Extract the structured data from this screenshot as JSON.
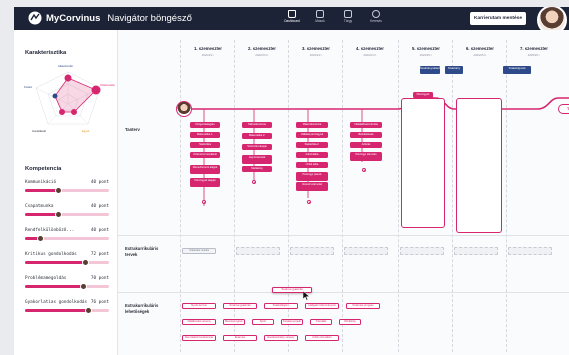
{
  "app": {
    "brand_bold": "MyCorvinus",
    "brand_rest": "Navigátor böngésző",
    "career_button": "Karrierutam mentése"
  },
  "nav": [
    {
      "label": "Dashboard",
      "icon": "home-icon",
      "active": true
    },
    {
      "label": "Mások",
      "icon": "document-icon",
      "active": false
    },
    {
      "label": "Tárgy",
      "icon": "file-icon",
      "active": false
    },
    {
      "label": "Keresés",
      "icon": "search-icon",
      "active": false
    }
  ],
  "left": {
    "characteristics_title": "Karakterisztika",
    "radar_labels": {
      "top": "Adatorientált",
      "right": "Üzletvezetés",
      "left": "Kreatív",
      "bottom_left": "Gondolkodó",
      "bottom_right": "Egyéb"
    },
    "competence_title": "Kompetencia",
    "skills": [
      {
        "name": "Kommunikáció",
        "points": "40 pont",
        "level": 0.4
      },
      {
        "name": "Csapatmunka",
        "points": "40 pont",
        "level": 0.4
      },
      {
        "name": "Rendfelkülönböző...",
        "points": "40 pont",
        "level": 0.18
      },
      {
        "name": "Kritikus gondolkodás",
        "points": "72 pont",
        "level": 0.72
      },
      {
        "name": "Problémamegoldás",
        "points": "70 pont",
        "level": 0.7
      },
      {
        "name": "Gyakorlatias gondolkodás",
        "points": "76 pont",
        "level": 0.76
      }
    ]
  },
  "semesters": [
    {
      "title": "1. szemeszter",
      "dates": "2022/23 I."
    },
    {
      "title": "2. szemeszter",
      "dates": "2022/23 II."
    },
    {
      "title": "3. szemeszter",
      "dates": "2023/24 I."
    },
    {
      "title": "4. szemeszter",
      "dates": "2023/24 II."
    },
    {
      "title": "5. szemeszter",
      "dates": "2024/25 I."
    },
    {
      "title": "6. szemeszter",
      "dates": "2024/25 II."
    },
    {
      "title": "7. szemeszter",
      "dates": "2025/26 I."
    }
  ],
  "semester_tags": [
    "Szakirányválasztás",
    "Szakirány",
    "Szakdolgozat"
  ],
  "rows": {
    "curriculum": "Tanterv",
    "extracurricular_plans": "Extrakurrikuláris tervek",
    "extracurricular_options": "Extrakurrikuláris lehetőségek"
  },
  "end_label": "Tan",
  "spec_label": "Pénzügyek",
  "courses": {
    "s1": [
      "Közgazdaságtan",
      "Matematika 1.",
      "Statisztika",
      "Üzleti kommunikáció",
      "Menedzsment alapjai",
      "Pénzügyek alapjai"
    ],
    "s2": [
      "Mikroökonómia",
      "Matematika 2.",
      "Számvitel alapjai",
      "Jogi ismeretek",
      "Marketing"
    ],
    "s3": [
      "Makroökonómia",
      "Vállalati pénzügyek",
      "Statisztika 2.",
      "Informatika",
      "Üzleti etika",
      "Pénzügyi piacok",
      "Vezetői számvitel"
    ],
    "s4": [
      "Vállalatfinanszírozás",
      "Befektetések",
      "Adózás",
      "Pénzügyi elemzés"
    ],
    "s5": [
      "Banki ügyletek",
      "Kockázatkezelés",
      "Biztosítás",
      "Pénzügyi modellezés",
      "Digitális pénzügyek",
      "Fenntartható pénzügyek",
      "Nemzetközi pénzügyek",
      "Szakdolgozat"
    ],
    "s6": [
      "Stratégiai menedzsment",
      "Pénzügyi tervezés",
      "Vállalatértékelés",
      "Portfóliókezelés",
      "Társasági jog",
      "Szakmai gyakorlat",
      "Projektmenedzsment",
      "Szakdolgozati szeminárium"
    ]
  },
  "extra_plans": [
    "Önkéntes munka"
  ],
  "extra_options": [
    [
      "Nyelvi kurzus",
      "Szakmai gyakorlat",
      "Szakkollégium",
      "Hallgatói önkormányzat",
      "Önkéntes program"
    ],
    [
      "Vállalkozási verseny",
      "Mentorprogram",
      "Sport",
      "Kutatási projekt",
      "Tutorálás",
      "Workshop"
    ],
    [
      "Nemzetközi konferencia",
      "Erasmus",
      "Esettanulmány verseny",
      "Üzleti szimuláció"
    ]
  ],
  "dragged_chip": "Szakmai gyakorlat"
}
